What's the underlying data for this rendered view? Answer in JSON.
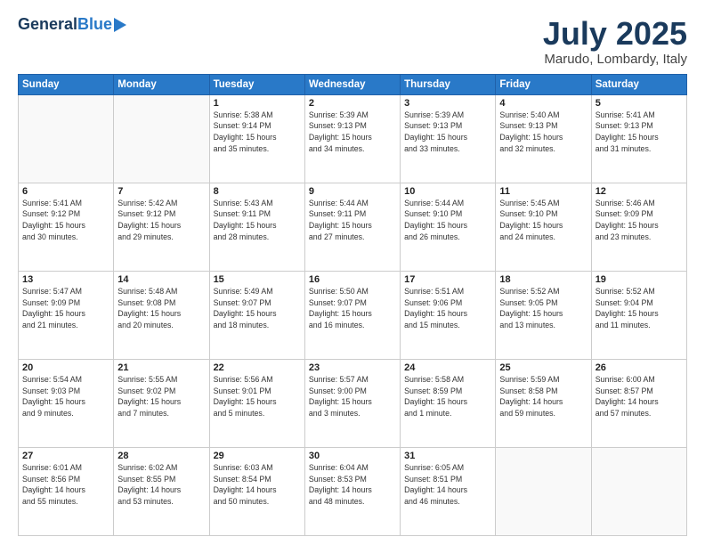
{
  "header": {
    "logo_general": "General",
    "logo_blue": "Blue",
    "month_title": "July 2025",
    "location": "Marudo, Lombardy, Italy"
  },
  "weekdays": [
    "Sunday",
    "Monday",
    "Tuesday",
    "Wednesday",
    "Thursday",
    "Friday",
    "Saturday"
  ],
  "weeks": [
    [
      {
        "day": "",
        "text": ""
      },
      {
        "day": "",
        "text": ""
      },
      {
        "day": "1",
        "text": "Sunrise: 5:38 AM\nSunset: 9:14 PM\nDaylight: 15 hours\nand 35 minutes."
      },
      {
        "day": "2",
        "text": "Sunrise: 5:39 AM\nSunset: 9:13 PM\nDaylight: 15 hours\nand 34 minutes."
      },
      {
        "day": "3",
        "text": "Sunrise: 5:39 AM\nSunset: 9:13 PM\nDaylight: 15 hours\nand 33 minutes."
      },
      {
        "day": "4",
        "text": "Sunrise: 5:40 AM\nSunset: 9:13 PM\nDaylight: 15 hours\nand 32 minutes."
      },
      {
        "day": "5",
        "text": "Sunrise: 5:41 AM\nSunset: 9:13 PM\nDaylight: 15 hours\nand 31 minutes."
      }
    ],
    [
      {
        "day": "6",
        "text": "Sunrise: 5:41 AM\nSunset: 9:12 PM\nDaylight: 15 hours\nand 30 minutes."
      },
      {
        "day": "7",
        "text": "Sunrise: 5:42 AM\nSunset: 9:12 PM\nDaylight: 15 hours\nand 29 minutes."
      },
      {
        "day": "8",
        "text": "Sunrise: 5:43 AM\nSunset: 9:11 PM\nDaylight: 15 hours\nand 28 minutes."
      },
      {
        "day": "9",
        "text": "Sunrise: 5:44 AM\nSunset: 9:11 PM\nDaylight: 15 hours\nand 27 minutes."
      },
      {
        "day": "10",
        "text": "Sunrise: 5:44 AM\nSunset: 9:10 PM\nDaylight: 15 hours\nand 26 minutes."
      },
      {
        "day": "11",
        "text": "Sunrise: 5:45 AM\nSunset: 9:10 PM\nDaylight: 15 hours\nand 24 minutes."
      },
      {
        "day": "12",
        "text": "Sunrise: 5:46 AM\nSunset: 9:09 PM\nDaylight: 15 hours\nand 23 minutes."
      }
    ],
    [
      {
        "day": "13",
        "text": "Sunrise: 5:47 AM\nSunset: 9:09 PM\nDaylight: 15 hours\nand 21 minutes."
      },
      {
        "day": "14",
        "text": "Sunrise: 5:48 AM\nSunset: 9:08 PM\nDaylight: 15 hours\nand 20 minutes."
      },
      {
        "day": "15",
        "text": "Sunrise: 5:49 AM\nSunset: 9:07 PM\nDaylight: 15 hours\nand 18 minutes."
      },
      {
        "day": "16",
        "text": "Sunrise: 5:50 AM\nSunset: 9:07 PM\nDaylight: 15 hours\nand 16 minutes."
      },
      {
        "day": "17",
        "text": "Sunrise: 5:51 AM\nSunset: 9:06 PM\nDaylight: 15 hours\nand 15 minutes."
      },
      {
        "day": "18",
        "text": "Sunrise: 5:52 AM\nSunset: 9:05 PM\nDaylight: 15 hours\nand 13 minutes."
      },
      {
        "day": "19",
        "text": "Sunrise: 5:52 AM\nSunset: 9:04 PM\nDaylight: 15 hours\nand 11 minutes."
      }
    ],
    [
      {
        "day": "20",
        "text": "Sunrise: 5:54 AM\nSunset: 9:03 PM\nDaylight: 15 hours\nand 9 minutes."
      },
      {
        "day": "21",
        "text": "Sunrise: 5:55 AM\nSunset: 9:02 PM\nDaylight: 15 hours\nand 7 minutes."
      },
      {
        "day": "22",
        "text": "Sunrise: 5:56 AM\nSunset: 9:01 PM\nDaylight: 15 hours\nand 5 minutes."
      },
      {
        "day": "23",
        "text": "Sunrise: 5:57 AM\nSunset: 9:00 PM\nDaylight: 15 hours\nand 3 minutes."
      },
      {
        "day": "24",
        "text": "Sunrise: 5:58 AM\nSunset: 8:59 PM\nDaylight: 15 hours\nand 1 minute."
      },
      {
        "day": "25",
        "text": "Sunrise: 5:59 AM\nSunset: 8:58 PM\nDaylight: 14 hours\nand 59 minutes."
      },
      {
        "day": "26",
        "text": "Sunrise: 6:00 AM\nSunset: 8:57 PM\nDaylight: 14 hours\nand 57 minutes."
      }
    ],
    [
      {
        "day": "27",
        "text": "Sunrise: 6:01 AM\nSunset: 8:56 PM\nDaylight: 14 hours\nand 55 minutes."
      },
      {
        "day": "28",
        "text": "Sunrise: 6:02 AM\nSunset: 8:55 PM\nDaylight: 14 hours\nand 53 minutes."
      },
      {
        "day": "29",
        "text": "Sunrise: 6:03 AM\nSunset: 8:54 PM\nDaylight: 14 hours\nand 50 minutes."
      },
      {
        "day": "30",
        "text": "Sunrise: 6:04 AM\nSunset: 8:53 PM\nDaylight: 14 hours\nand 48 minutes."
      },
      {
        "day": "31",
        "text": "Sunrise: 6:05 AM\nSunset: 8:51 PM\nDaylight: 14 hours\nand 46 minutes."
      },
      {
        "day": "",
        "text": ""
      },
      {
        "day": "",
        "text": ""
      }
    ]
  ]
}
